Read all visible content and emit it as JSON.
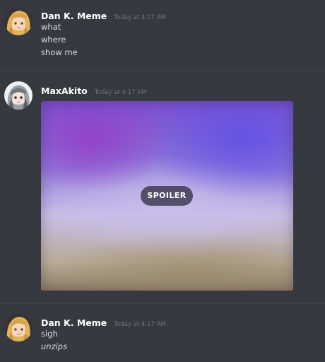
{
  "messages": [
    {
      "username": "Dan K. Meme",
      "timestamp": "Today at 4:17 AM",
      "lines": [
        "what",
        "where",
        "show me"
      ]
    },
    {
      "username": "MaxAkito",
      "timestamp": "Today at 4:17 AM",
      "attachment": {
        "spoiler_label": "SPOILER"
      }
    },
    {
      "username": "Dan K. Meme",
      "timestamp": "Today at 4:17 AM",
      "lines": [
        "sigh",
        "unzips"
      ]
    }
  ],
  "colors": {
    "background": "#36393f",
    "username": "#ffffff",
    "timestamp": "#72767d",
    "message_text": "#dcddde"
  },
  "icons": {
    "avatar_dan": "avatar-blonde-anime-icon",
    "avatar_max": "avatar-silver-hair-anime-icon"
  }
}
